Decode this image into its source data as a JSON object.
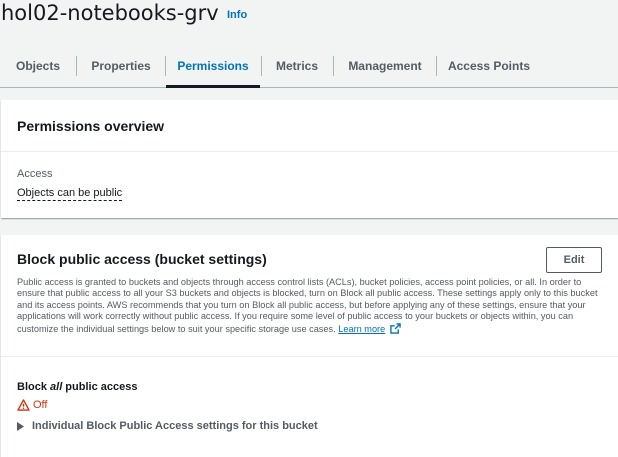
{
  "header": {
    "title": "hol02-notebooks-grv",
    "info_label": "Info"
  },
  "tabs": [
    {
      "label": "Objects",
      "active": false
    },
    {
      "label": "Properties",
      "active": false
    },
    {
      "label": "Permissions",
      "active": true
    },
    {
      "label": "Metrics",
      "active": false
    },
    {
      "label": "Management",
      "active": false
    },
    {
      "label": "Access Points",
      "active": false
    }
  ],
  "overview": {
    "title": "Permissions overview",
    "access_label": "Access",
    "access_value": "Objects can be public"
  },
  "block_public_access": {
    "title": "Block public access (bucket settings)",
    "edit_label": "Edit",
    "description": "Public access is granted to buckets and objects through access control lists (ACLs), bucket policies, access point policies, or all. In order to ensure that public access to all your S3 buckets and objects is blocked, turn on Block all public access. These settings apply only to this bucket and its access points. AWS recommends that you turn on Block all public access, but before applying any of these settings, ensure that your applications will work correctly without public access. If you require some level of public access to your buckets or objects within, you can customize the individual settings below to suit your specific storage use cases.",
    "learn_more": "Learn more",
    "block_all_prefix": "Block ",
    "block_all_emph": "all",
    "block_all_suffix": " public access",
    "status": "Off",
    "status_icon": "warning-icon",
    "expander_label": "Individual Block Public Access settings for this bucket"
  },
  "colors": {
    "link": "#0073bb",
    "warning": "#d13212",
    "text": "#16191f",
    "muted": "#545b64",
    "background": "#f2f3f3"
  }
}
